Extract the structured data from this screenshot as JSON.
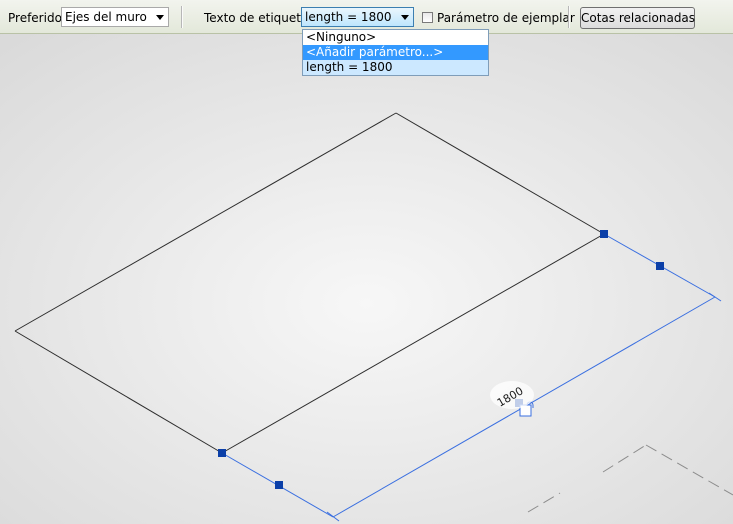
{
  "toolbar": {
    "preferred_label": "Preferido:",
    "preferred_value": "Ejes del muro",
    "tag_text_label": "Texto de etiqueta:",
    "tag_text_value": "length = 1800",
    "instance_param_label": "Parámetro de ejemplar",
    "instance_param_checked": false,
    "related_dims_label": "Cotas relacionadas"
  },
  "dropdown": {
    "options": [
      "<Ninguno>",
      "<Añadir parámetro...>",
      "length = 1800"
    ],
    "highlighted": "<Añadir parámetro...>",
    "selected": "length = 1800"
  },
  "viewport": {
    "dimension_value": "1800",
    "colors": {
      "background": "#e6e6e6",
      "edge": "#2d2d2d",
      "dimension_line": "#3a6fe0",
      "grip": "#0b3fa8"
    }
  }
}
